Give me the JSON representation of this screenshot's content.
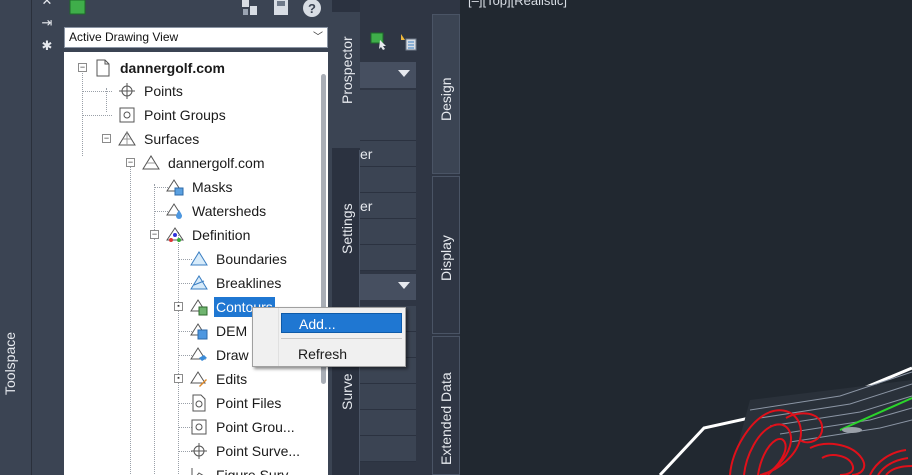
{
  "toolspace": {
    "title": "Toolspace",
    "strip_icons": [
      "close-icon",
      "pin-icon",
      "gear-icon"
    ]
  },
  "panel": {
    "view_selector": "Active Drawing View",
    "toolbar_icons": [
      "drawing-icon",
      "transfer-icon",
      "save-icon",
      "help-icon"
    ]
  },
  "tree": {
    "root": "dannergolf.com",
    "points": "Points",
    "point_groups": "Point Groups",
    "surfaces": "Surfaces",
    "surface_name": "dannergolf.com",
    "masks": "Masks",
    "watersheds": "Watersheds",
    "definition": "Definition",
    "boundaries": "Boundaries",
    "breaklines": "Breaklines",
    "contours": "Contours",
    "dem": "DEM",
    "drawing": "Draw",
    "edits": "Edits",
    "point_files": "Point Files",
    "point_groups_def": "Point Grou...",
    "point_survey": "Point Surve...",
    "figure_survey": "Figure Surv..."
  },
  "tabs": {
    "prospector": "Prospector",
    "settings": "Settings",
    "survey": "Surve",
    "design": "Design",
    "display": "Display",
    "extended_data": "Extended Data"
  },
  "mid": {
    "row1": "er",
    "row2": "er"
  },
  "viewport": {
    "label": "[–][Top][Realistic]"
  },
  "context_menu": {
    "add": "Add...",
    "refresh": "Refresh"
  }
}
